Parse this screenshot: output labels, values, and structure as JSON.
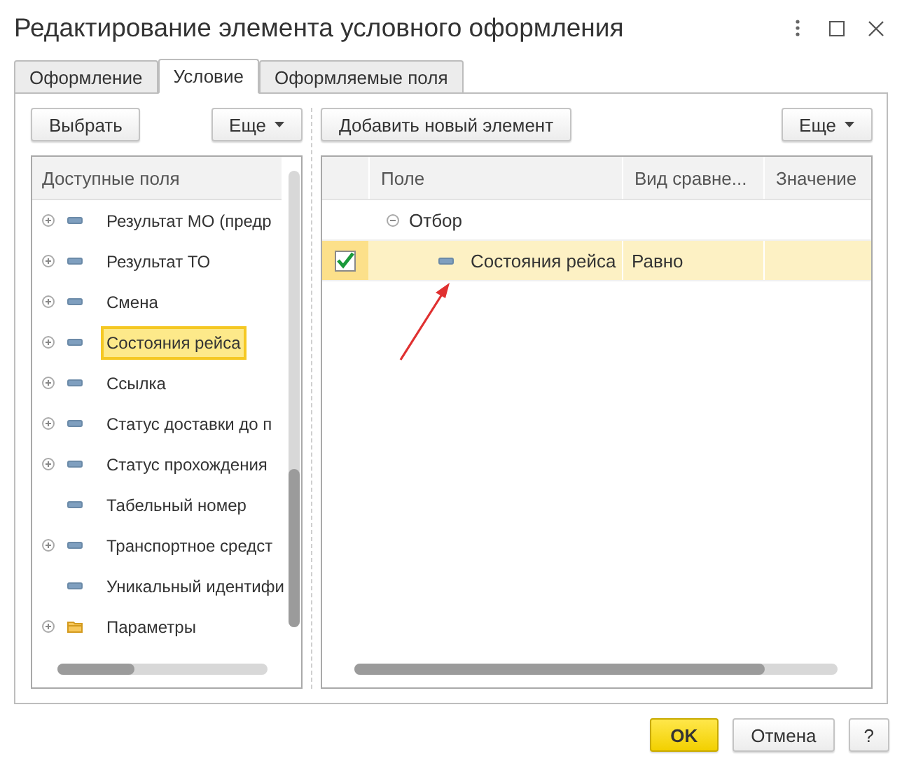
{
  "window": {
    "title": "Редактирование элемента условного оформления"
  },
  "tabs": [
    {
      "label": "Оформление",
      "selected": false
    },
    {
      "label": "Условие",
      "selected": true
    },
    {
      "label": "Оформляемые поля",
      "selected": false
    }
  ],
  "left_toolbar": {
    "select_button": "Выбрать",
    "more_button": "Еще"
  },
  "right_toolbar": {
    "add_button": "Добавить новый элемент",
    "more_button": "Еще"
  },
  "available_fields": {
    "header": "Доступные поля",
    "items": [
      {
        "label": "Результат МО (предр",
        "kind": "field",
        "expandable": true,
        "selected": false
      },
      {
        "label": "Результат ТО",
        "kind": "field",
        "expandable": true,
        "selected": false
      },
      {
        "label": "Смена",
        "kind": "field",
        "expandable": true,
        "selected": false
      },
      {
        "label": "Состояния рейса",
        "kind": "field",
        "expandable": true,
        "selected": true
      },
      {
        "label": "Ссылка",
        "kind": "field",
        "expandable": true,
        "selected": false
      },
      {
        "label": "Статус доставки до п",
        "kind": "field",
        "expandable": true,
        "selected": false
      },
      {
        "label": "Статус прохождения",
        "kind": "field",
        "expandable": true,
        "selected": false
      },
      {
        "label": "Табельный номер",
        "kind": "field",
        "expandable": false,
        "selected": false
      },
      {
        "label": "Транспортное средст",
        "kind": "field",
        "expandable": true,
        "selected": false
      },
      {
        "label": "Уникальный идентифи",
        "kind": "field",
        "expandable": false,
        "selected": false
      },
      {
        "label": "Параметры",
        "kind": "folder",
        "expandable": true,
        "selected": false
      }
    ]
  },
  "conditions": {
    "columns": [
      "Поле",
      "Вид сравне...",
      "Значение"
    ],
    "rows": [
      {
        "field": "Отбор",
        "expanded": true,
        "children": [
          {
            "field": "Состояния рейса",
            "comparison": "Равно",
            "checked": true,
            "selected": true
          }
        ]
      }
    ]
  },
  "buttons": {
    "ok": "OK",
    "cancel": "Отмена",
    "help": "?"
  }
}
